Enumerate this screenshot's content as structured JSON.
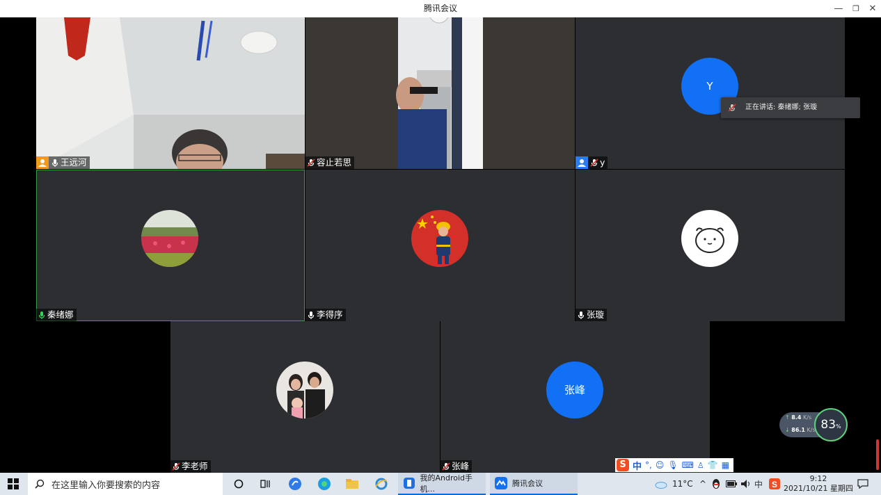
{
  "window": {
    "title": "腾讯会议",
    "minimize_glyph": "—",
    "restore_glyph": "❐",
    "close_glyph": "✕"
  },
  "participants": [
    {
      "name": "王远河",
      "mic": "on",
      "role": "host",
      "view": "video-room"
    },
    {
      "name": "容止若思",
      "mic": "muted",
      "view": "video-man"
    },
    {
      "name": "y",
      "mic": "muted",
      "role": "cohost",
      "avatar_text": "Y"
    },
    {
      "name": "秦绪娜",
      "mic": "speaking",
      "avatar_image": "tulip-field",
      "active": true
    },
    {
      "name": "李得序",
      "mic": "on",
      "avatar_image": "firefighter-flag"
    },
    {
      "name": "张璇",
      "mic": "on",
      "avatar_image": "cartoon-face"
    },
    {
      "name": "李老师",
      "mic": "muted",
      "avatar_image": "family-photo"
    },
    {
      "name": "张峰",
      "mic": "muted",
      "avatar_text": "张峰"
    }
  ],
  "speaking_tooltip": {
    "text": "正在讲话: 秦绪娜; 张璇"
  },
  "net_widget": {
    "upload": "8.4",
    "upload_unit": "K/s",
    "download": "86.1",
    "download_unit": "K/s",
    "percent": "83",
    "percent_unit": "%"
  },
  "taskbar": {
    "search_placeholder": "在这里输入你要搜索的内容",
    "apps": [
      {
        "label": "我的Android手机...",
        "icon": "phone-link-icon"
      },
      {
        "label": "腾讯会议",
        "icon": "tencent-meeting-icon"
      }
    ],
    "weather": "11°C",
    "ime_indicator": "中",
    "time": "9:12",
    "date": "2021/10/21 星期四"
  },
  "colors": {
    "accent_blue": "#1270f5",
    "speaking_green": "#3c9e4a",
    "tile_bg": "#2c2e32"
  }
}
